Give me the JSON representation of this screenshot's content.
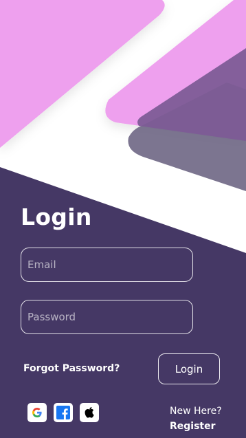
{
  "login": {
    "title": "Login",
    "email_placeholder": "Email",
    "password_placeholder": "Password",
    "forgot_label": "Forgot Password?",
    "login_button_label": "Login",
    "new_here_label": "New Here?",
    "register_label": "Register"
  },
  "social": [
    "google-icon",
    "facebook-icon",
    "apple-icon"
  ],
  "colors": {
    "background": "#ffffff",
    "panel": "#453865",
    "shape_pink": "#eea0ee",
    "shape_violet": "#7d5c96",
    "shape_slate": "#6e6684",
    "text": "#ffffff"
  }
}
